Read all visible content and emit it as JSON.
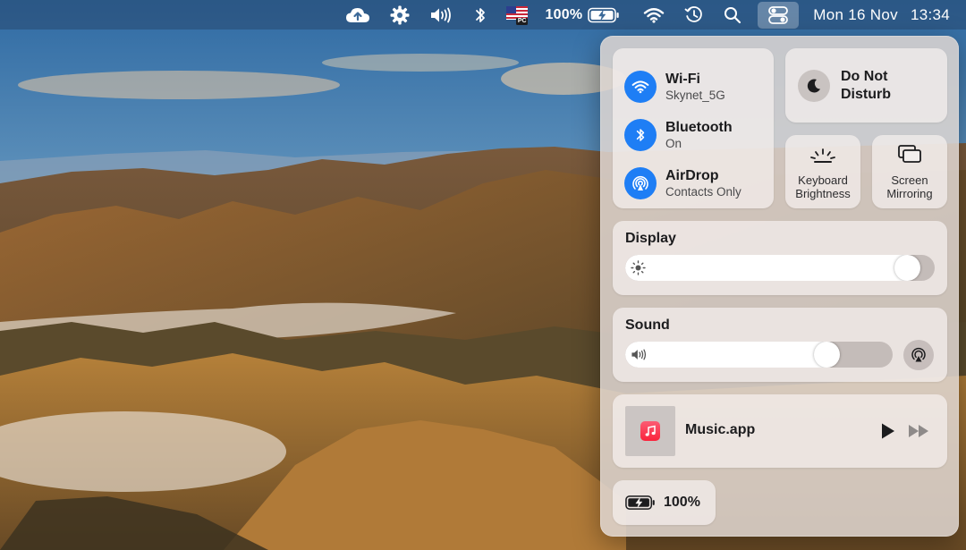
{
  "menubar": {
    "icons": [
      "cloud-upload-icon",
      "gear-icon",
      "speaker-icon",
      "bluetooth-icon",
      "us-flag-input-icon",
      "battery-charging-icon",
      "wifi-icon",
      "time-machine-icon",
      "search-icon",
      "control-center-icon"
    ],
    "input_source_label": "PC",
    "battery_percent": "100%",
    "date": "Mon 16 Nov",
    "time": "13:34"
  },
  "control_center": {
    "wifi": {
      "title": "Wi-Fi",
      "subtitle": "Skynet_5G",
      "icon": "wifi-icon",
      "active": true
    },
    "bluetooth": {
      "title": "Bluetooth",
      "subtitle": "On",
      "icon": "bluetooth-icon",
      "active": true
    },
    "airdrop": {
      "title": "AirDrop",
      "subtitle": "Contacts Only",
      "icon": "airdrop-icon",
      "active": true
    },
    "dnd": {
      "title": "Do Not Disturb",
      "icon": "moon-icon",
      "active": false
    },
    "keyboard_brightness": {
      "label": "Keyboard Brightness",
      "icon": "keyboard-brightness-icon"
    },
    "screen_mirroring": {
      "label": "Screen Mirroring",
      "icon": "screen-mirroring-icon"
    },
    "display": {
      "heading": "Display",
      "icon": "sun-icon",
      "level": 0.95
    },
    "sound": {
      "heading": "Sound",
      "icon": "speaker-icon",
      "level": 0.78
    },
    "now_playing": {
      "app": "Music.app",
      "icon": "music-note-icon"
    },
    "battery": {
      "percent": "100%",
      "icon": "battery-charging-icon"
    }
  },
  "colors": {
    "accent_blue": "#1e7ef5",
    "panel_bg": "#ded6d2",
    "music_red": "#fa233b"
  }
}
